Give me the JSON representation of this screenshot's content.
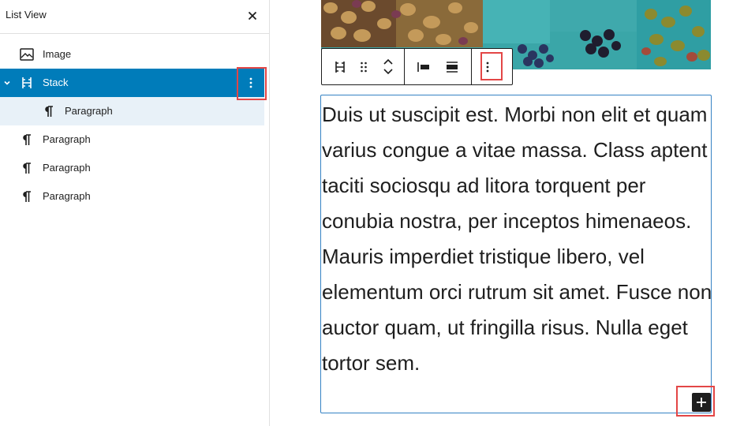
{
  "list_view": {
    "title": "List View",
    "close_icon": "close-icon",
    "items": [
      {
        "label": "Image",
        "icon": "image-icon"
      },
      {
        "label": "Stack",
        "icon": "stack-icon",
        "selected": true,
        "expanded": true
      },
      {
        "label": "Paragraph",
        "icon": "paragraph-icon",
        "nested": true
      },
      {
        "label": "Paragraph",
        "icon": "paragraph-icon"
      },
      {
        "label": "Paragraph",
        "icon": "paragraph-icon"
      },
      {
        "label": "Paragraph",
        "icon": "paragraph-icon"
      }
    ]
  },
  "block_toolbar": {
    "buttons": [
      "stack-icon",
      "drag-handle-icon",
      "move-up-down-icon",
      "justify-left-icon",
      "align-center-icon",
      "more-options-icon"
    ]
  },
  "paragraph": {
    "text": "Duis ut suscipit est. Morbi non elit et quam varius congue a vitae massa. Class aptent taciti sociosqu ad litora torquent per conubia nostra, per inceptos himenaeos. Mauris imperdiet tristique libero, vel elementum orci rutrum sit amet. Fusce non auctor quam, ut fringilla risus. Nulla eget tortor sem."
  },
  "colors": {
    "accent": "#007cba",
    "selected_child_bg": "#e8f1f8",
    "highlight": "#e34646",
    "block_border": "#3582c4"
  }
}
